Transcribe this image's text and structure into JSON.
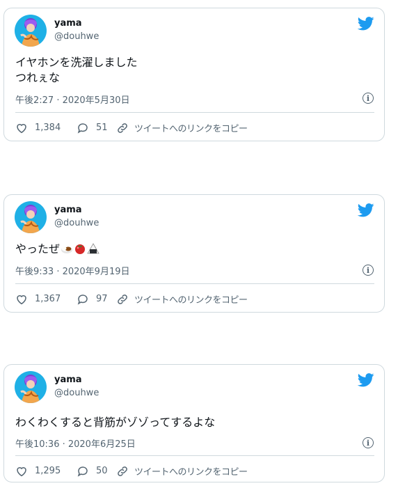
{
  "colors": {
    "brand": "#1d9bf0",
    "text": "#0f1419",
    "secondary": "#536471",
    "border": "#cfd9de"
  },
  "tweets": [
    {
      "name": "yama",
      "handle": "@douhwe",
      "text_line1": "イヤホンを洗濯しました",
      "text_line2": "つれぇな",
      "timestamp": "午後2:27 · 2020年5月30日",
      "likes": "1,384",
      "replies": "51",
      "copy_link": "ツイートへのリンクをコピー"
    },
    {
      "name": "yama",
      "handle": "@douhwe",
      "text_line1": "やったぜ",
      "emojis": [
        "curry-rice-emoji",
        "tomato-emoji",
        "onigiri-emoji"
      ],
      "timestamp": "午後9:33 · 2020年9月19日",
      "likes": "1,367",
      "replies": "97",
      "copy_link": "ツイートへのリンクをコピー"
    },
    {
      "name": "yama",
      "handle": "@douhwe",
      "text_line1": "わくわくすると背筋がゾゾってするよな",
      "timestamp": "午後10:36 · 2020年6月25日",
      "likes": "1,295",
      "replies": "50",
      "copy_link": "ツイートへのリンクをコピー"
    }
  ]
}
